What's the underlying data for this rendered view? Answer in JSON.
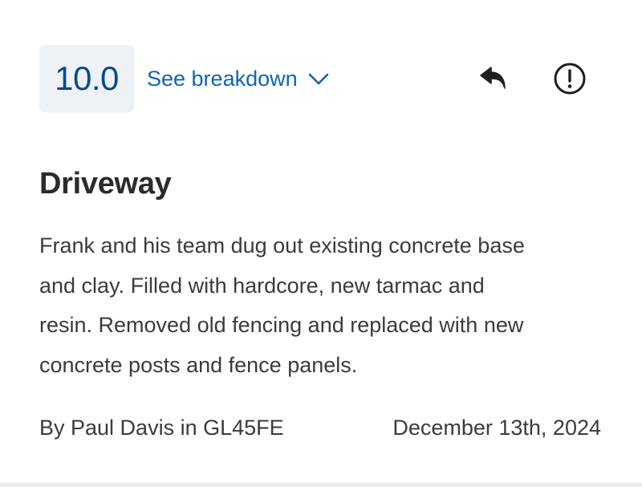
{
  "review": {
    "score": "10.0",
    "breakdown_label": "See breakdown",
    "title": "Driveway",
    "body": "Frank and his team dug out existing concrete base\nand clay. Filled with hardcore, new tarmac and\nresin. Removed  old fencing and replaced with new\nconcrete posts and fence panels.",
    "author_line": "By Paul Davis in GL45FE",
    "date": "December 13th, 2024"
  },
  "icons": {
    "breakdown": "chevron-down-icon",
    "reply": "reply-icon",
    "report": "alert-circle-icon"
  },
  "colors": {
    "score_text": "#0a4a8c",
    "score_bg": "#eef2f7",
    "link": "#1064b4",
    "text": "#3b3b3b",
    "icon": "#1f1f1f"
  }
}
